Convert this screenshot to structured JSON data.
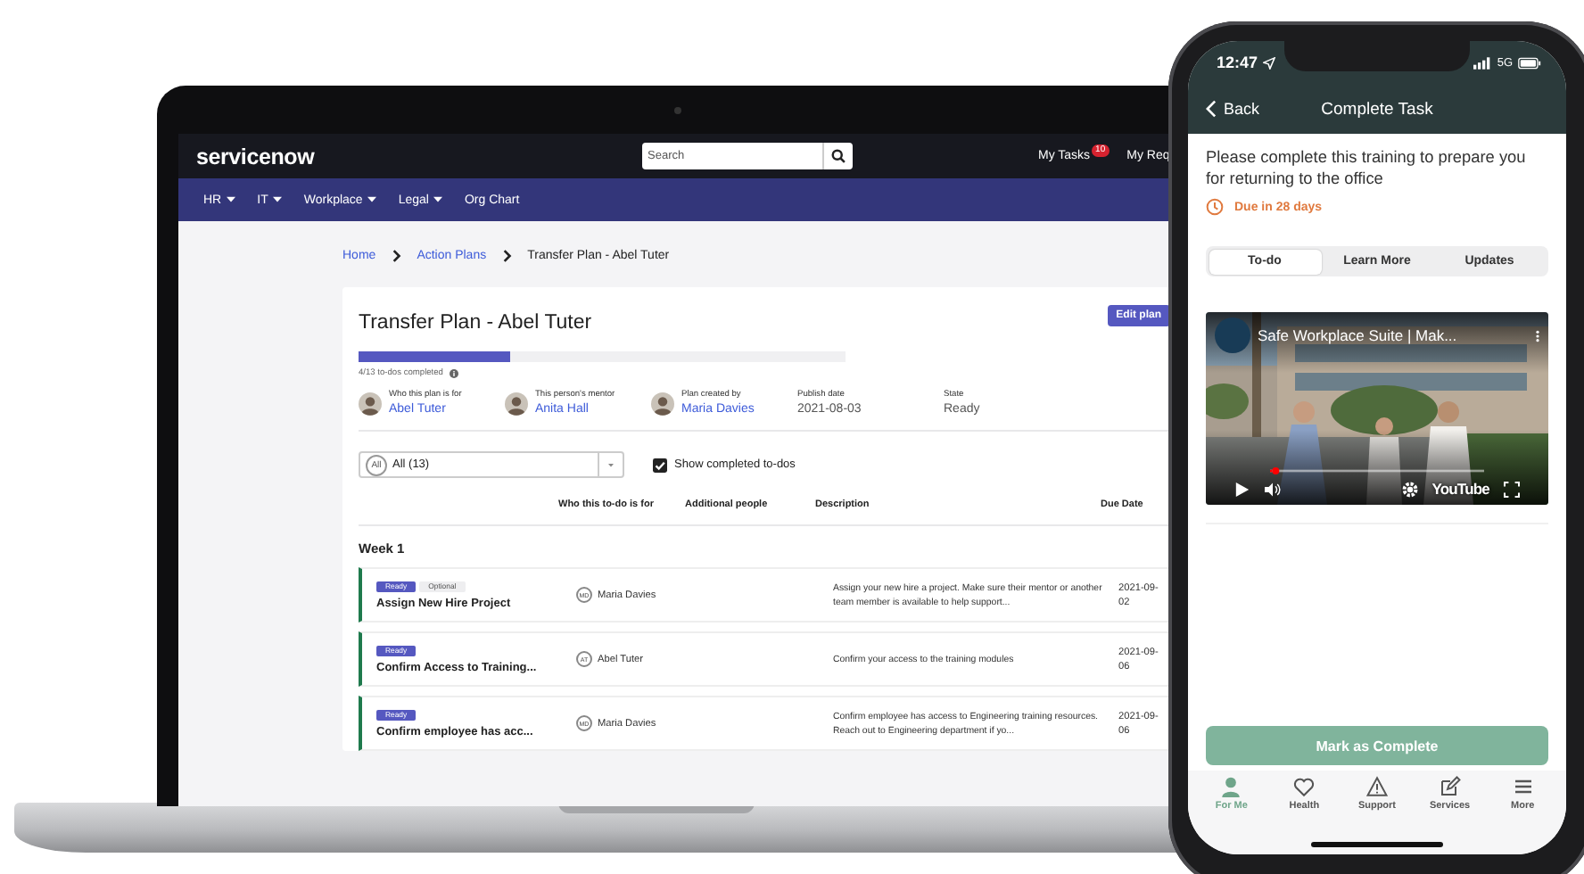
{
  "laptop": {
    "brand": "servicenow",
    "search": {
      "placeholder": "Search"
    },
    "header_links": [
      {
        "label": "My Tasks",
        "badge": "10"
      },
      {
        "label": "My Req"
      }
    ],
    "nav": [
      {
        "label": "HR",
        "dropdown": true
      },
      {
        "label": "IT",
        "dropdown": true
      },
      {
        "label": "Workplace",
        "dropdown": true
      },
      {
        "label": "Legal",
        "dropdown": true
      },
      {
        "label": "Org Chart",
        "dropdown": false
      }
    ],
    "breadcrumb": [
      {
        "label": "Home",
        "kind": "link"
      },
      {
        "label": "Action Plans",
        "kind": "link"
      },
      {
        "label": "Transfer Plan - Abel Tuter",
        "kind": "current"
      }
    ],
    "plan": {
      "title": "Transfer Plan - Abel Tuter",
      "edit_button": "Edit plan",
      "progress": {
        "level": 0.31,
        "label": "4/13 to-dos completed"
      },
      "meta": [
        {
          "label": "Who this plan is for",
          "value": "Abel Tuter",
          "kind": "person"
        },
        {
          "label": "This person's mentor",
          "value": "Anita Hall",
          "kind": "person"
        },
        {
          "label": "Plan created by",
          "value": "Maria Davies",
          "kind": "person"
        },
        {
          "label": "Publish date",
          "value": "2021-08-03",
          "kind": "text"
        },
        {
          "label": "State",
          "value": "Ready",
          "kind": "text"
        }
      ],
      "filter": {
        "badge": "All",
        "value": "All (13)"
      },
      "show_completed": {
        "label": "Show completed to-dos",
        "checked": true
      },
      "columns": [
        "Who this to-do is for",
        "Additional people",
        "Description",
        "Due Date"
      ],
      "group": "Week 1",
      "rows": [
        {
          "tags": [
            {
              "label": "Ready",
              "kind": "status"
            },
            {
              "label": "Optional",
              "kind": "optional"
            }
          ],
          "title": "Assign New Hire Project",
          "initials": "MD",
          "person": "Maria Davies",
          "description": "Assign your new hire a project. Make sure their mentor or another team member is available to help support...",
          "due": "2021-09-02"
        },
        {
          "tags": [
            {
              "label": "Ready",
              "kind": "status"
            }
          ],
          "title": "Confirm Access to Training...",
          "initials": "AT",
          "person": "Abel Tuter",
          "description": "Confirm your access to the training modules",
          "due": "2021-09-06"
        },
        {
          "tags": [
            {
              "label": "Ready",
              "kind": "status"
            }
          ],
          "title": "Confirm employee has acc...",
          "initials": "MD",
          "person": "Maria Davies",
          "description": "Confirm employee has access to Engineering training resources. Reach out to Engineering department if yo...",
          "due": "2021-09-06"
        }
      ]
    }
  },
  "phone": {
    "time": "12:47",
    "network": "5G",
    "back": "Back",
    "title": "Complete Task",
    "message": "Please complete this training to prepare you for returning to the office",
    "due": "Due in 28 days",
    "segments": [
      {
        "label": "To-do",
        "selected": true
      },
      {
        "label": "Learn More",
        "selected": false
      },
      {
        "label": "Updates",
        "selected": false
      }
    ],
    "video": {
      "title": "Safe Workplace Suite | Mak...",
      "logo": "YouTube",
      "progress": {
        "level": 0.01
      }
    },
    "action_button": "Mark as Complete",
    "tab_bar": [
      {
        "label": "For Me",
        "selected": true
      },
      {
        "label": "Health",
        "selected": false
      },
      {
        "label": "Support",
        "selected": false
      },
      {
        "label": "Services",
        "selected": false
      },
      {
        "label": "More",
        "selected": false
      }
    ]
  }
}
